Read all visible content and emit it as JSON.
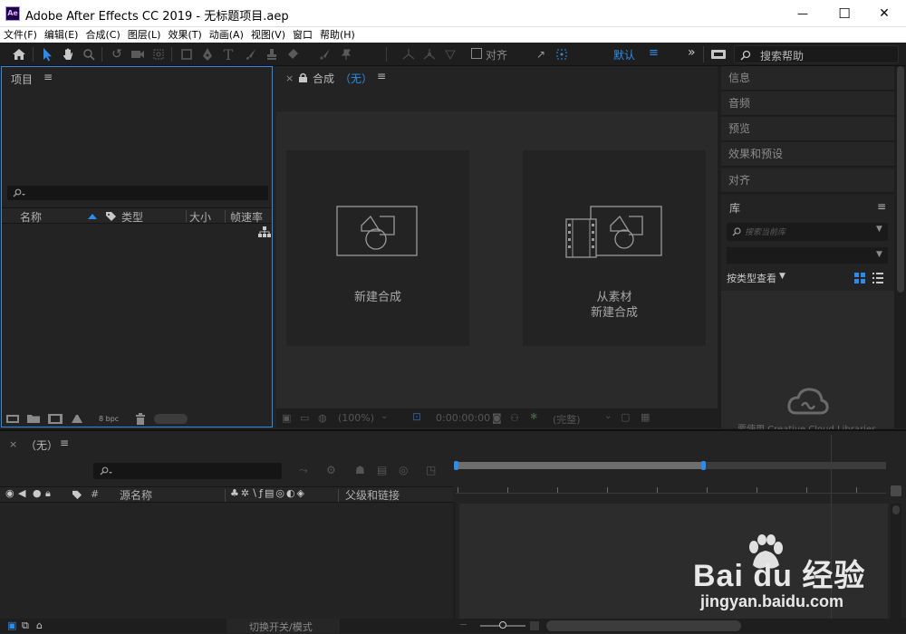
{
  "window": {
    "app_icon_text": "Ae",
    "title": "Adobe After Effects CC 2019 - 无标题项目.aep",
    "minimize": "—",
    "maximize": "☐",
    "close": "✕"
  },
  "menu": [
    "文件(F)",
    "编辑(E)",
    "合成(C)",
    "图层(L)",
    "效果(T)",
    "动画(A)",
    "视图(V)",
    "窗口",
    "帮助(H)"
  ],
  "toolbar": {
    "align_label": "对齐",
    "workspace": "默认",
    "workspace_menu": "≡",
    "more": "»",
    "search_placeholder": "搜索帮助"
  },
  "project": {
    "title": "项目",
    "menu": "≡",
    "columns": [
      "名称",
      "类型",
      "大小",
      "帧速率"
    ],
    "bpc": "8 bpc"
  },
  "composition": {
    "close": "×",
    "title": "合成",
    "name": "（无）",
    "menu": "≡",
    "new_comp_label": "新建合成",
    "from_footage_line1": "从素材",
    "from_footage_line2": "新建合成",
    "footer": {
      "zoom": "(100%)",
      "timecode": "0:00:00:00",
      "quality": "(完整)"
    }
  },
  "right_panels": [
    "信息",
    "音频",
    "预览",
    "效果和预设",
    "对齐"
  ],
  "library": {
    "title": "库",
    "menu": "≡",
    "search_placeholder": "搜索当前库",
    "view_by": "按类型查看",
    "cc_text": "要使用 Creative Cloud Libraries"
  },
  "timeline": {
    "close": "×",
    "name": "（无）",
    "menu": "≡",
    "source_name": "源名称",
    "parent": "父级和链接",
    "hash": "#",
    "footer_toggle": "切换开关/模式"
  },
  "watermark": {
    "brand": "Bai du 经验",
    "url": "jingyan.baidu.com"
  },
  "colors": {
    "accent": "#2d8ceb",
    "panel": "#232323",
    "field": "#151515"
  }
}
